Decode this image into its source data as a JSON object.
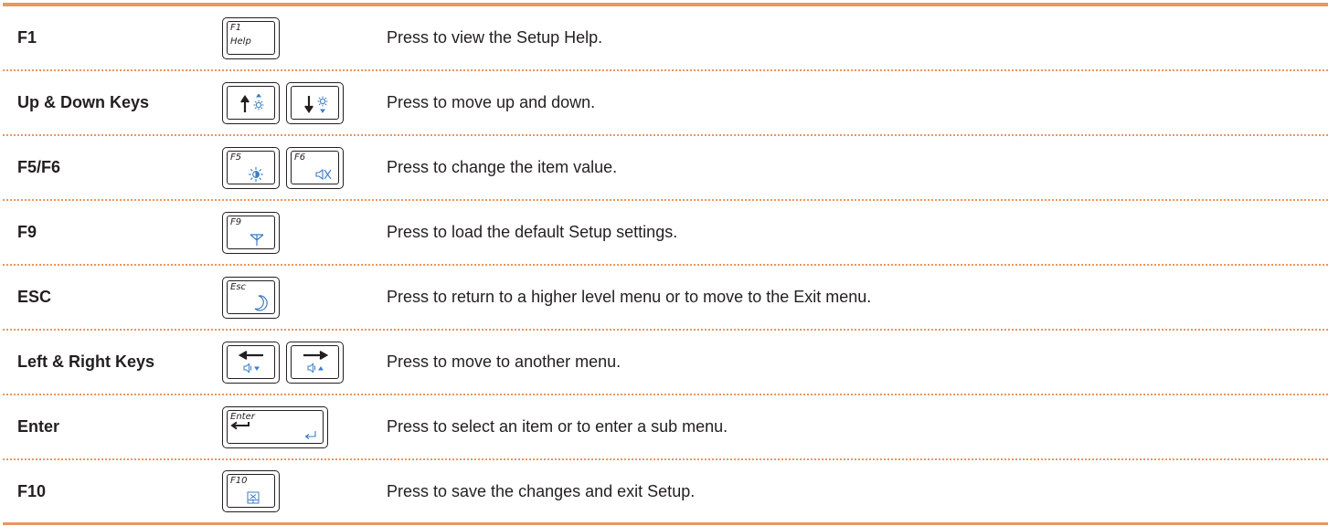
{
  "accent_color": "#e9965f",
  "icon_color": "#3b7cc4",
  "rows": [
    {
      "name": "F1",
      "description": "Press to view the Setup Help.",
      "keys": [
        {
          "label": "F1",
          "sub_label": "Help"
        }
      ]
    },
    {
      "name": "Up & Down Keys",
      "description": "Press to move up and down.",
      "keys": [
        {
          "icon": "arrow-up-brightness-up-icon"
        },
        {
          "icon": "arrow-down-brightness-down-icon"
        }
      ]
    },
    {
      "name": "F5/F6",
      "description": "Press to change the item value.",
      "keys": [
        {
          "label": "F5",
          "icon": "brightness-icon"
        },
        {
          "label": "F6",
          "icon": "mute-icon"
        }
      ]
    },
    {
      "name": "F9",
      "description": "Press to load the default Setup settings.",
      "keys": [
        {
          "label": "F9",
          "icon": "wireless-icon"
        }
      ]
    },
    {
      "name": "ESC",
      "description": "Press to return to a higher level menu or to move to the Exit menu.",
      "keys": [
        {
          "label": "Esc",
          "icon": "sleep-moon-icon"
        }
      ]
    },
    {
      "name": "Left & Right Keys",
      "description": "Press to move to another menu.",
      "keys": [
        {
          "icon": "arrow-left-volume-down-icon"
        },
        {
          "icon": "arrow-right-volume-up-icon"
        }
      ]
    },
    {
      "name": "Enter",
      "description": "Press to select an item or to enter a sub menu.",
      "keys": [
        {
          "label": "Enter",
          "icon": "enter-icon"
        }
      ]
    },
    {
      "name": "F10",
      "description": "Press to save the changes and exit Setup.",
      "keys": [
        {
          "label": "F10",
          "icon": "touchpad-icon"
        }
      ]
    }
  ]
}
